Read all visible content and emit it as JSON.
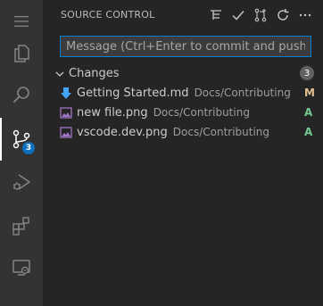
{
  "activity_bar": {
    "items": [
      {
        "name": "explorer-icon"
      },
      {
        "name": "search-icon"
      },
      {
        "name": "source-control-icon",
        "active": true,
        "badge": "3"
      },
      {
        "name": "run-and-debug-icon"
      },
      {
        "name": "extensions-icon"
      },
      {
        "name": "remote-explorer-icon"
      }
    ]
  },
  "panel": {
    "title": "SOURCE CONTROL",
    "actions": [
      "view-as-tree-icon",
      "commit-check-icon",
      "branch-icon",
      "refresh-icon",
      "more-actions-icon"
    ],
    "commit_placeholder": "Message (Ctrl+Enter to commit and push to 'm...",
    "changes": {
      "label": "Changes",
      "count": "3",
      "files": [
        {
          "name": "Getting Started.md",
          "dir": "Docs/Contributing",
          "status": "M",
          "icon": "markdown-file-icon"
        },
        {
          "name": "new file.png",
          "dir": "Docs/Contributing",
          "status": "A",
          "icon": "image-file-icon"
        },
        {
          "name": "vscode.dev.png",
          "dir": "Docs/Contributing",
          "status": "A",
          "icon": "image-file-icon"
        }
      ]
    }
  },
  "colors": {
    "accent": "#007fd4",
    "modified": "#e2c08d",
    "added": "#73c991",
    "badge": "#0e70c0"
  }
}
